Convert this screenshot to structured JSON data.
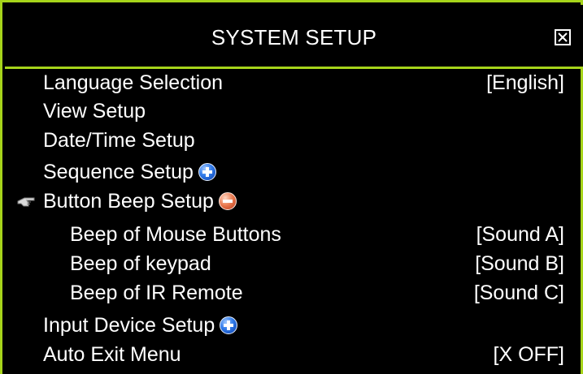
{
  "window": {
    "title": "SYSTEM SETUP",
    "close_icon": "close-box-icon"
  },
  "menu": {
    "items": [
      {
        "label": "Language Selection",
        "value": "[English]"
      },
      {
        "label": "View Setup",
        "value": ""
      },
      {
        "label": "Date/Time Setup",
        "value": ""
      },
      {
        "label": "Sequence Setup",
        "value": "",
        "icon": "expand-plus-icon"
      },
      {
        "label": "Button Beep Setup",
        "value": "",
        "icon": "collapse-minus-icon",
        "selected": true
      },
      {
        "label": "Beep of Mouse Buttons",
        "value": "[Sound A]"
      },
      {
        "label": "Beep of keypad",
        "value": "[Sound B]"
      },
      {
        "label": "Beep of IR Remote",
        "value": "[Sound C]"
      },
      {
        "label": "Input Device Setup",
        "value": "",
        "icon": "expand-plus-icon"
      },
      {
        "label": "Auto Exit Menu",
        "value": "[X OFF]"
      }
    ]
  },
  "colors": {
    "background": "#000000",
    "border": "#a6d41a",
    "text": "#ffffff",
    "plus_icon": "#2f79e8",
    "minus_icon": "#e8774d"
  }
}
